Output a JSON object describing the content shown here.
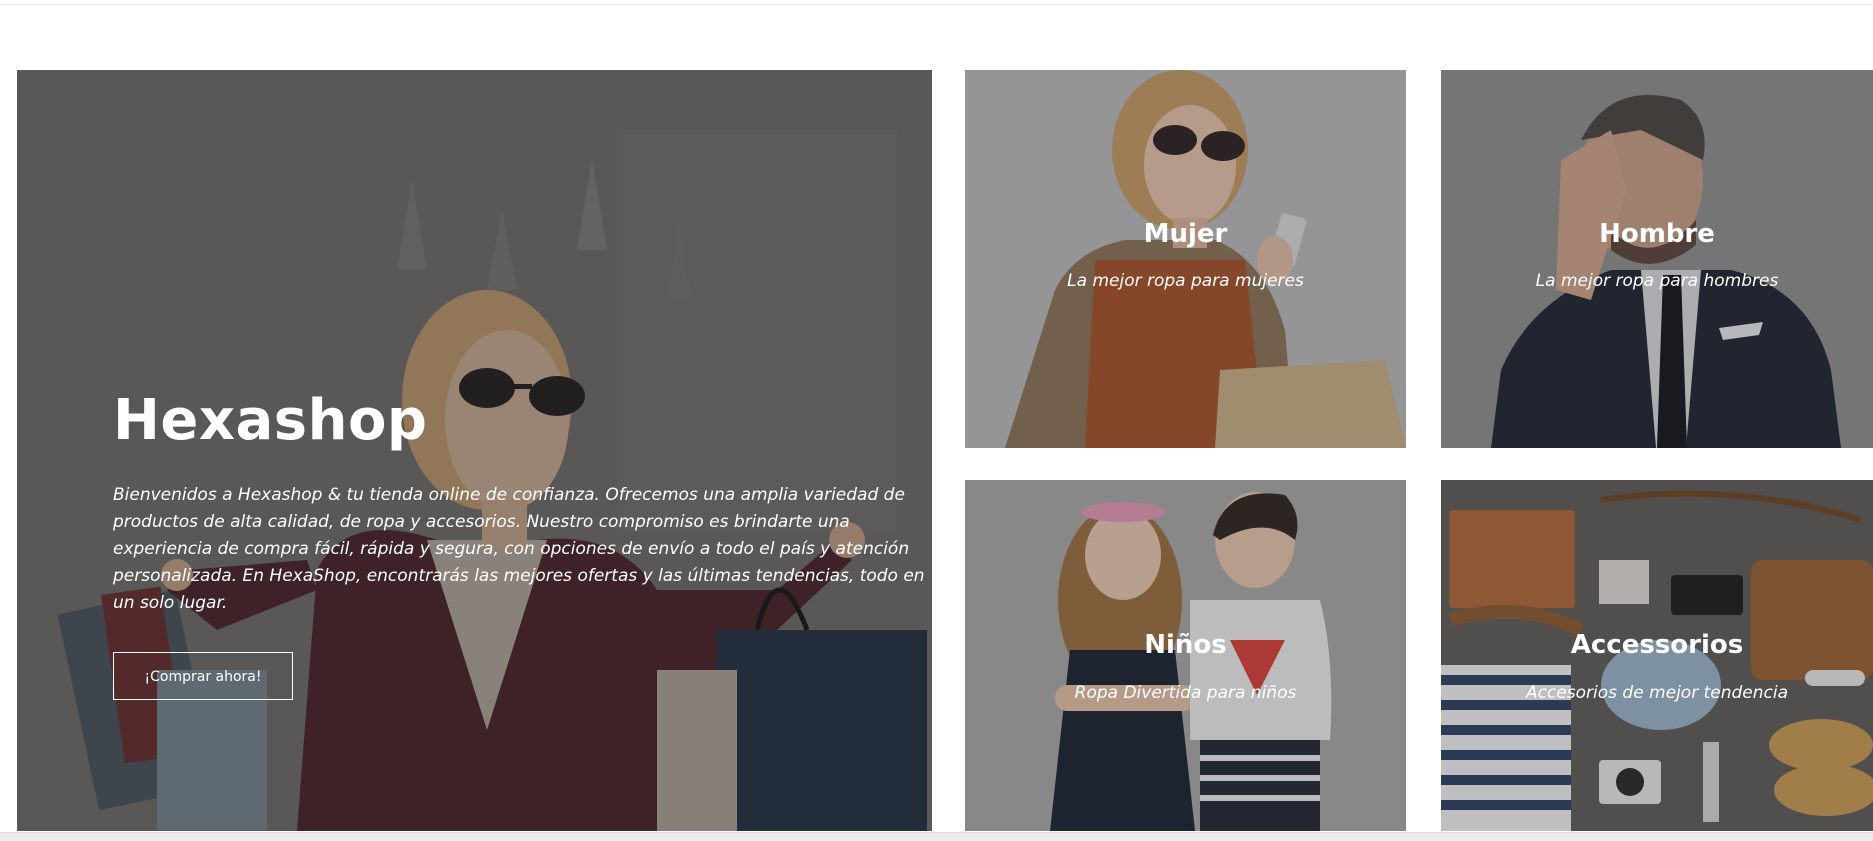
{
  "hero": {
    "title": "Hexashop",
    "description": "Bienvenidos a Hexashop & tu tienda online de confianza. Ofrecemos una amplia variedad de productos de alta calidad, de ropa y accesorios. Nuestro compromiso es brindarte una experiencia de compra fácil, rápida y segura, con opciones de envío a todo el país y atención personalizada. En HexaShop, encontrarás las mejores ofertas y las últimas tendencias, todo en un solo lugar.",
    "button_label": "¡Comprar ahora!"
  },
  "categories": [
    {
      "title": "Mujer",
      "subtitle": "La mejor ropa para mujeres"
    },
    {
      "title": "Hombre",
      "subtitle": "La mejor ropa para hombres"
    },
    {
      "title": "Niños",
      "subtitle": "Ropa Divertida para niños"
    },
    {
      "title": "Accessorios",
      "subtitle": "Accesorios de mejor tendencia"
    }
  ],
  "icons": {
    "hero_image": "shopping-woman-photo",
    "women_image": "woman-with-shopping-bag-photo",
    "men_image": "man-in-suit-photo",
    "kids_image": "two-kids-photo",
    "accessories_image": "accessories-flatlay-photo"
  },
  "colors": {
    "text": "#ffffff",
    "overlay": "#282828",
    "background": "#ffffff"
  }
}
